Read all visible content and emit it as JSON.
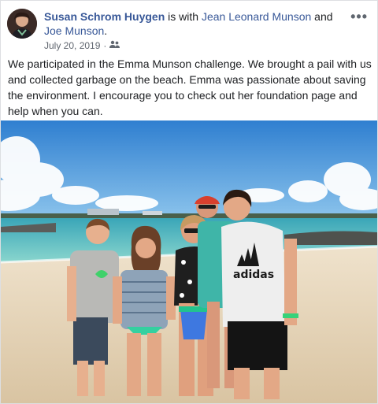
{
  "post": {
    "author": "Susan Schrom Huygen",
    "with_text": " is with ",
    "friend_1": "Jean Leonard Munson",
    "and_text": " and ",
    "friend_2": "Joe Munson",
    "period": ".",
    "date": "July 20, 2019",
    "separator": "·",
    "privacy_icon": "friends-icon",
    "more_label": "•••",
    "body": "We participated in the Emma Munson challenge. We brought a pail with us and collected garbage on the beach. Emma was passionate about saving the environment. I encourage you to check out her foundation page and help when you can."
  },
  "photo": {
    "shirt_text": "adidas"
  },
  "colors": {
    "link": "#385898",
    "meta": "#616770",
    "sky": "#5aa0dc",
    "sea": "#5fc2c0",
    "sand": "#e8d8c0"
  }
}
